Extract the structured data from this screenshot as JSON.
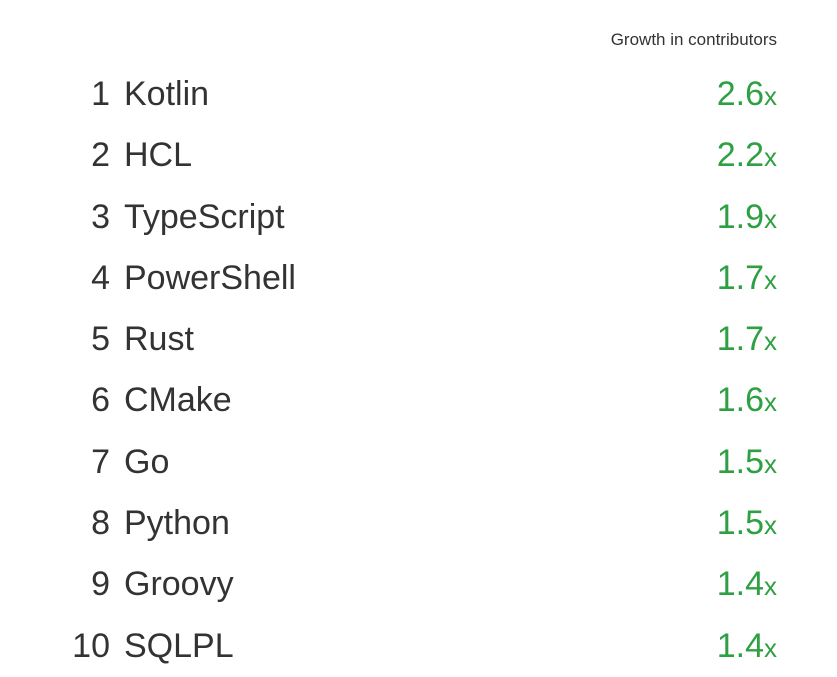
{
  "header": "Growth in contributors",
  "suffix": "x",
  "chart_data": {
    "type": "table",
    "title": "Growth in contributors",
    "categories": [
      "Kotlin",
      "HCL",
      "TypeScript",
      "PowerShell",
      "Rust",
      "CMake",
      "Go",
      "Python",
      "Groovy",
      "SQLPL"
    ],
    "values": [
      2.6,
      2.2,
      1.9,
      1.7,
      1.7,
      1.6,
      1.5,
      1.5,
      1.4,
      1.4
    ],
    "rows": [
      {
        "rank": 1,
        "language": "Kotlin",
        "growth": "2.6"
      },
      {
        "rank": 2,
        "language": "HCL",
        "growth": "2.2"
      },
      {
        "rank": 3,
        "language": "TypeScript",
        "growth": "1.9"
      },
      {
        "rank": 4,
        "language": "PowerShell",
        "growth": "1.7"
      },
      {
        "rank": 5,
        "language": "Rust",
        "growth": "1.7"
      },
      {
        "rank": 6,
        "language": "CMake",
        "growth": "1.6"
      },
      {
        "rank": 7,
        "language": "Go",
        "growth": "1.5"
      },
      {
        "rank": 8,
        "language": "Python",
        "growth": "1.5"
      },
      {
        "rank": 9,
        "language": "Groovy",
        "growth": "1.4"
      },
      {
        "rank": 10,
        "language": "SQLPL",
        "growth": "1.4"
      }
    ]
  }
}
